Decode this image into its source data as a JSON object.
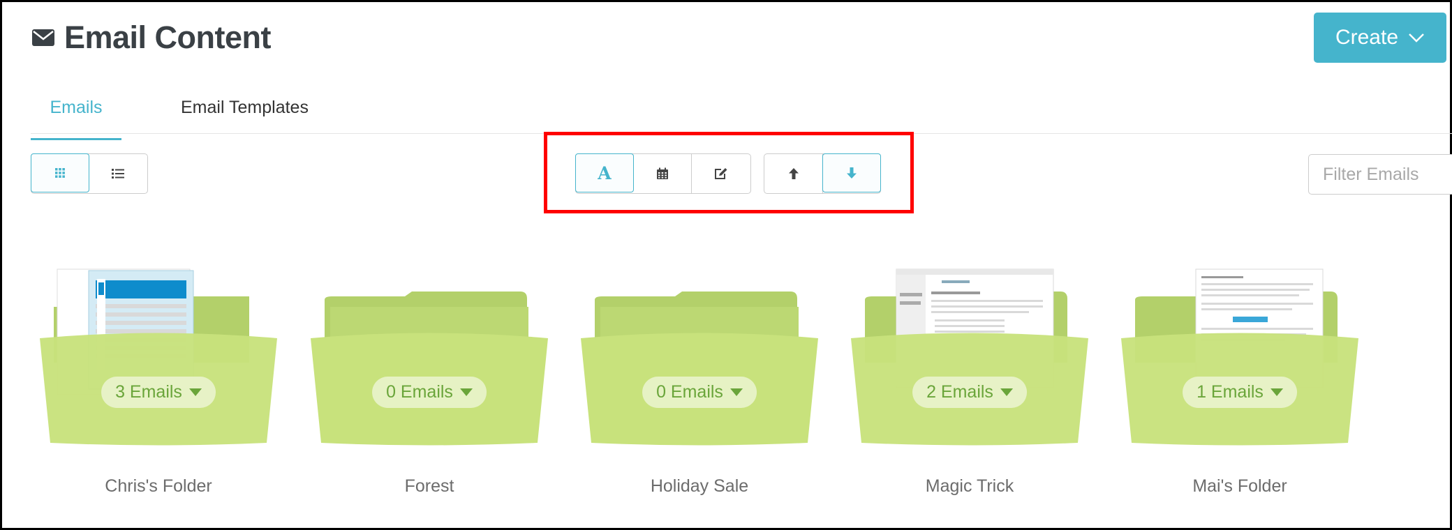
{
  "header": {
    "title": "Email Content",
    "title_icon": "envelope-icon",
    "create_label": "Create"
  },
  "tabs": [
    {
      "label": "Emails",
      "active": true
    },
    {
      "label": "Email Templates",
      "active": false
    }
  ],
  "view_toggle": {
    "options": [
      {
        "name": "grid-view",
        "icon": "grid-icon",
        "active": true
      },
      {
        "name": "list-view",
        "icon": "list-icon",
        "active": false
      }
    ]
  },
  "sort_by": {
    "options": [
      {
        "name": "sort-alphabetical",
        "icon": "letter-a-icon",
        "glyph": "A",
        "active": true
      },
      {
        "name": "sort-date",
        "icon": "calendar-icon",
        "active": false
      },
      {
        "name": "sort-modified",
        "icon": "edit-icon",
        "active": false
      }
    ]
  },
  "sort_direction": {
    "options": [
      {
        "name": "sort-ascending",
        "icon": "arrow-up-icon",
        "active": false
      },
      {
        "name": "sort-descending",
        "icon": "arrow-down-icon",
        "active": true
      }
    ]
  },
  "filter": {
    "placeholder": "Filter Emails",
    "value": ""
  },
  "folders": [
    {
      "name": "Chris's Folder",
      "count_label": "3 Emails",
      "preview": "newsletter"
    },
    {
      "name": "Forest",
      "count_label": "0 Emails",
      "preview": "empty"
    },
    {
      "name": "Holiday Sale",
      "count_label": "0 Emails",
      "preview": "empty"
    },
    {
      "name": "Magic Trick",
      "count_label": "2 Emails",
      "preview": "email"
    },
    {
      "name": "Mai's Folder",
      "count_label": "1 Emails",
      "preview": "email"
    }
  ],
  "colors": {
    "accent": "#45b4cc",
    "folder_green": "#c8e27c",
    "folder_dark": "#b3d06a",
    "count_text": "#6aa53a",
    "highlight": "#ff0000"
  }
}
